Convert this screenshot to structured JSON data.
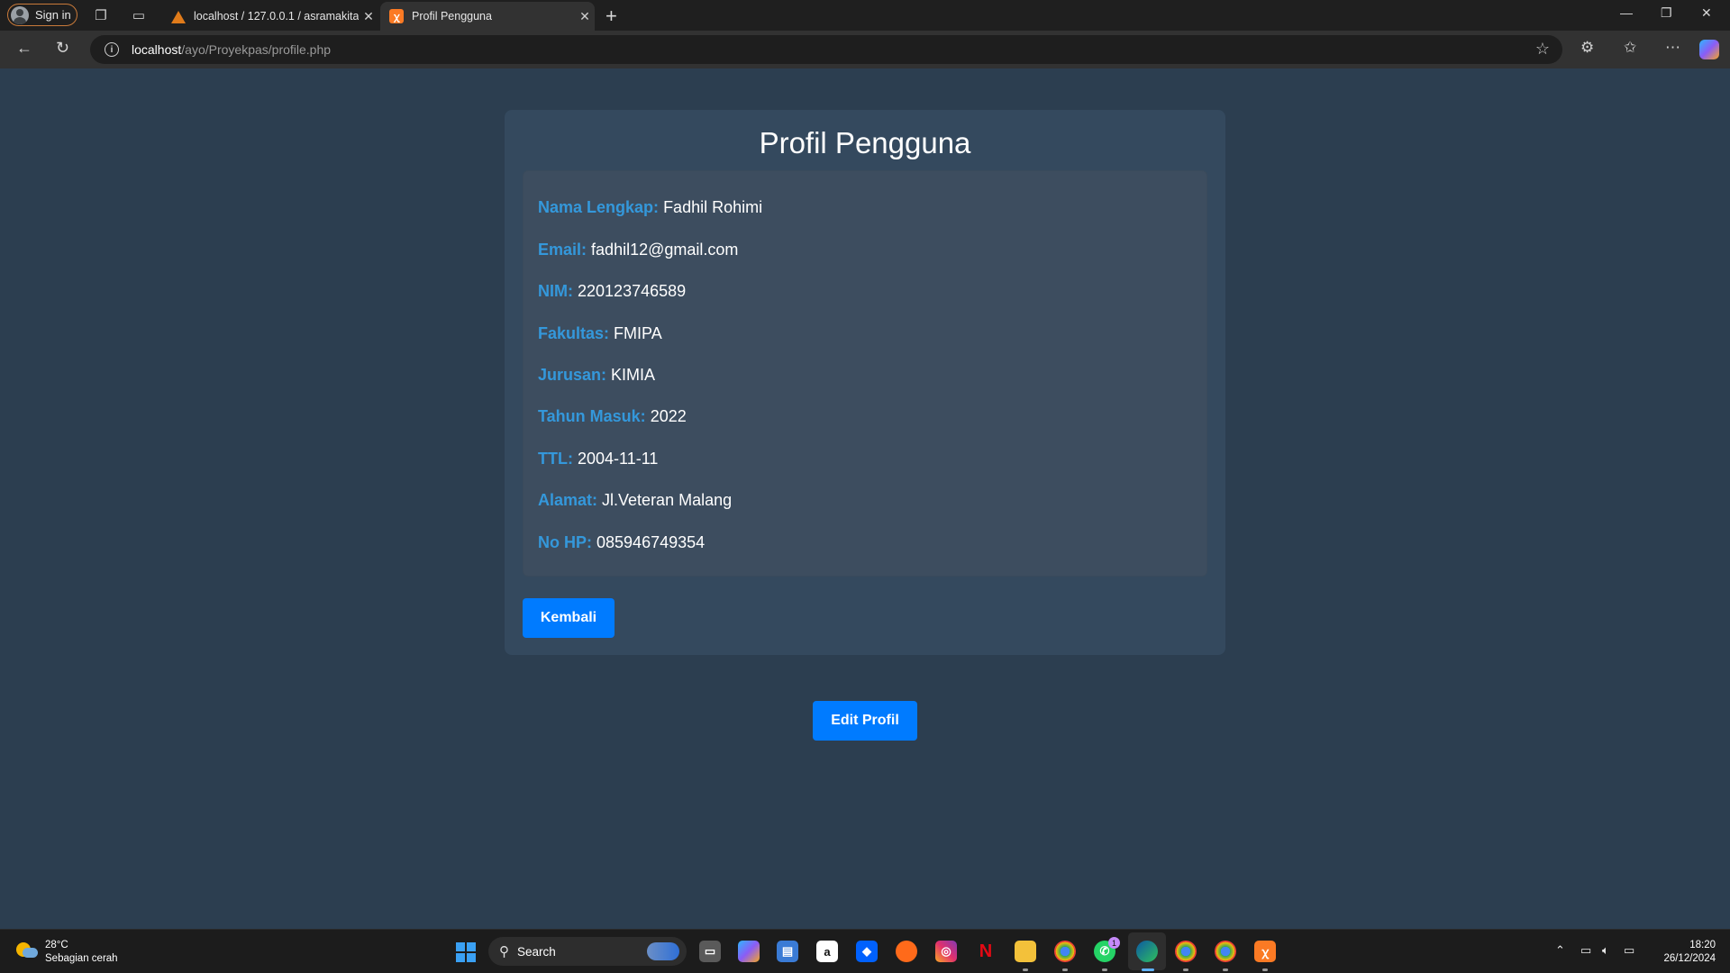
{
  "browser": {
    "signin_label": "Sign in",
    "tabs": [
      {
        "title": "localhost / 127.0.0.1 / asramakita",
        "favicon": "phpmyadmin-icon"
      },
      {
        "title": "Profil Pengguna",
        "favicon": "xampp-icon"
      }
    ],
    "url_host": "localhost",
    "url_path": "/ayo/Proyekpas/profile.php"
  },
  "page": {
    "title": "Profil Pengguna",
    "fields": [
      {
        "label": "Nama Lengkap:",
        "value": "Fadhil Rohimi"
      },
      {
        "label": "Email:",
        "value": "fadhil12@gmail.com"
      },
      {
        "label": "NIM:",
        "value": "220123746589"
      },
      {
        "label": "Fakultas:",
        "value": "FMIPA"
      },
      {
        "label": "Jurusan:",
        "value": "KIMIA"
      },
      {
        "label": "Tahun Masuk:",
        "value": "2022"
      },
      {
        "label": "TTL:",
        "value": "2004-11-11"
      },
      {
        "label": "Alamat:",
        "value": "Jl.Veteran Malang"
      },
      {
        "label": "No HP:",
        "value": "085946749354"
      }
    ],
    "back_button": "Kembali",
    "edit_button": "Edit Profil"
  },
  "taskbar": {
    "weather_temp": "28°C",
    "weather_desc": "Sebagian cerah",
    "search_placeholder": "Search",
    "time": "18:20",
    "date": "26/12/2024",
    "whatsapp_badge": "1"
  },
  "colors": {
    "page_bg": "#2c3e50",
    "card_bg": "#34495e",
    "label": "#3498db",
    "button": "#007bff"
  }
}
